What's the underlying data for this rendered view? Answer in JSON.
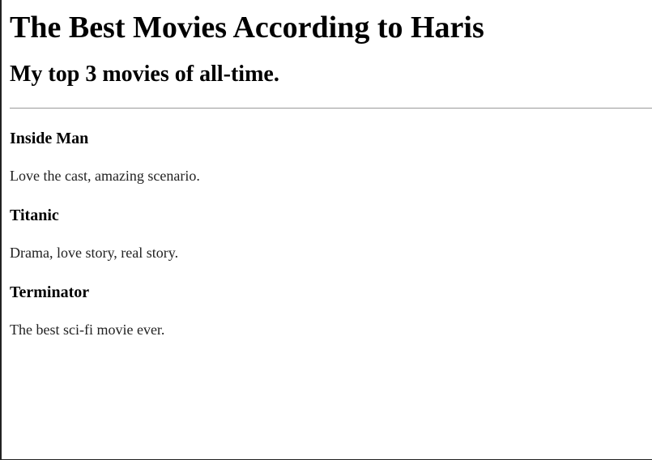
{
  "page": {
    "title": "The Best Movies According to Haris",
    "subtitle": "My top 3 movies of all-time."
  },
  "movies": [
    {
      "title": "Inside Man",
      "description": "Love the cast, amazing scenario."
    },
    {
      "title": "Titanic",
      "description": "Drama, love story, real story."
    },
    {
      "title": "Terminator",
      "description": "The best sci-fi movie ever."
    }
  ]
}
